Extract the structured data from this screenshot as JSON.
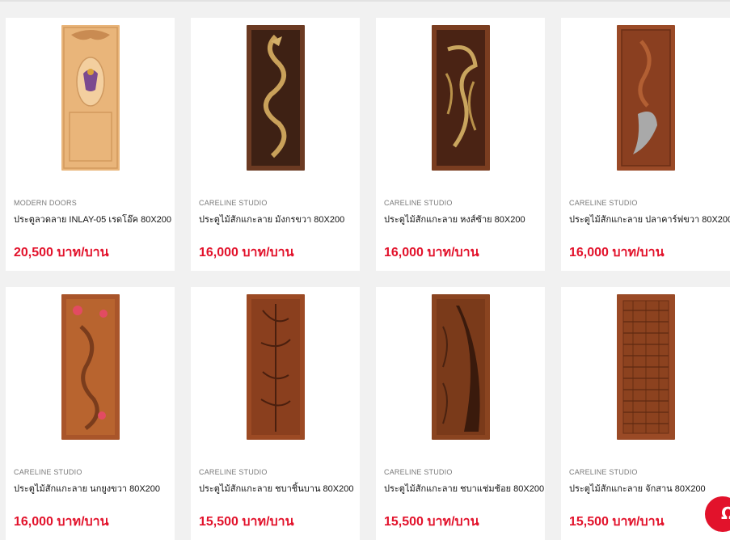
{
  "products": [
    {
      "brand": "MODERN DOORS",
      "name": "ประตูลวดลาย INLAY-05 เรดโอ๊ค 80X200",
      "price": "20,500 บาท/บาน",
      "image_icon": "door-image"
    },
    {
      "brand": "CARELINE STUDIO",
      "name": "ประตูไม้สักแกะลาย มังกรขวา 80X200",
      "price": "16,000 บาท/บาน",
      "image_icon": "door-image"
    },
    {
      "brand": "CARELINE STUDIO",
      "name": "ประตูไม้สักแกะลาย หงส์ซ้าย 80X200",
      "price": "16,000 บาท/บาน",
      "image_icon": "door-image"
    },
    {
      "brand": "CARELINE STUDIO",
      "name": "ประตูไม้สักแกะลาย ปลาคาร์ฟขวา 80X200",
      "price": "16,000 บาท/บาน",
      "image_icon": "door-image"
    },
    {
      "brand": "CARELINE STUDIO",
      "name": "ประตูไม้สักแกะลาย นกยูงขวา 80X200",
      "price": "16,000 บาท/บาน",
      "image_icon": "door-image"
    },
    {
      "brand": "CARELINE STUDIO",
      "name": "ประตูไม้สักแกะลาย ชบาชิ้นบาน 80X200",
      "price": "15,500 บาท/บาน",
      "image_icon": "door-image"
    },
    {
      "brand": "CARELINE STUDIO",
      "name": "ประตูไม้สักแกะลาย ชบาแช่มช้อย 80X200",
      "price": "15,500 บาท/บาน",
      "image_icon": "door-image"
    },
    {
      "brand": "CARELINE STUDIO",
      "name": "ประตูไม้สักแกะลาย จักสาน 80X200",
      "price": "15,500 บาท/บาน",
      "image_icon": "door-image"
    }
  ],
  "chat_icon": "chat-icon",
  "colors": {
    "price": "#e2122b",
    "background": "#f1f1f1",
    "card": "#ffffff",
    "brand_text": "#7a7a7a"
  }
}
